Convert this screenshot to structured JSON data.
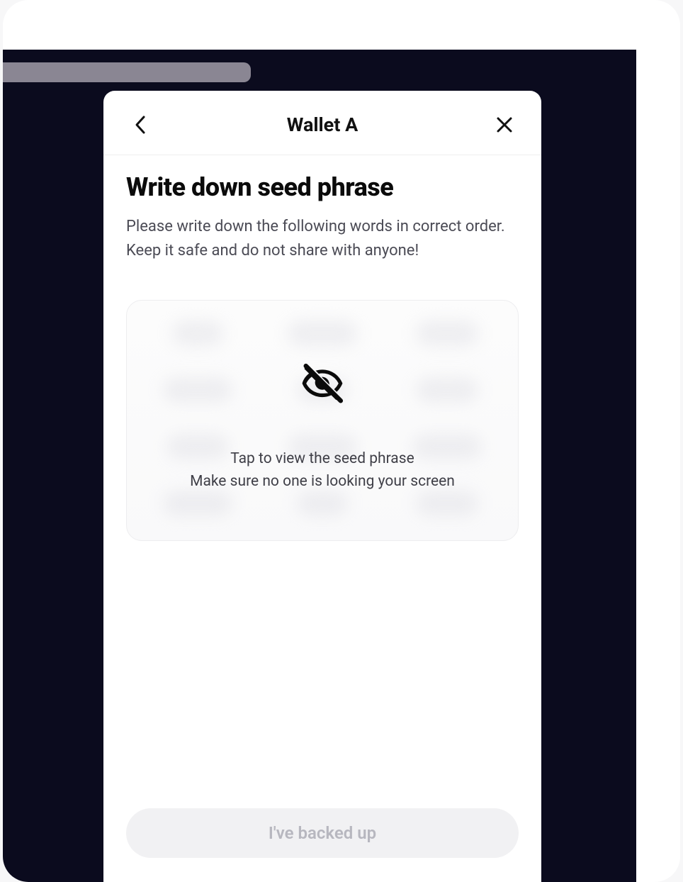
{
  "header": {
    "title": "Wallet A",
    "back_icon": "chevron-left",
    "close_icon": "close"
  },
  "main": {
    "heading": "Write down seed phrase",
    "description": "Please write down the following words in correct order. Keep it safe and do not share with anyone!"
  },
  "seed_overlay": {
    "icon": "eye-off",
    "line1": "Tap to view the seed phrase",
    "line2": "Make sure no one is looking your screen"
  },
  "footer": {
    "cta_label": "I've backed up"
  }
}
